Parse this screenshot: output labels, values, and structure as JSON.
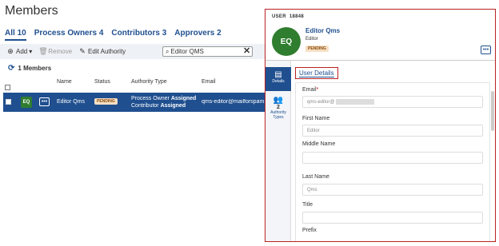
{
  "page": {
    "title": "Members"
  },
  "tabs": [
    {
      "label": "All",
      "count": "10",
      "active": true
    },
    {
      "label": "Process Owners",
      "count": "4"
    },
    {
      "label": "Contributors",
      "count": "3"
    },
    {
      "label": "Approvers",
      "count": "2"
    }
  ],
  "toolbar": {
    "add_label": "Add",
    "remove_label": "Remove",
    "edit_label": "Edit Authority",
    "search_value": "Editor QMS"
  },
  "list": {
    "count_label": "1 Members"
  },
  "table": {
    "headers": {
      "name": "Name",
      "status": "Status",
      "authority": "Authority Type",
      "email": "Email"
    },
    "row": {
      "initials": "EQ",
      "more": "•••",
      "name": "Editor Qms",
      "status": "PENDING",
      "authority_line1": "Process Owner",
      "authority_line1_status": "Assigned",
      "authority_line2": "Contributor",
      "authority_line2_status": "Assigned",
      "email": "qms-editor@mailforspam..."
    }
  },
  "panel": {
    "user_label": "USER",
    "user_id": "18848",
    "initials": "EQ",
    "name": "Editor Qms",
    "role": "Editor",
    "status": "PENDING",
    "more": "•••",
    "nav": {
      "details_label": "Details",
      "types_count": "2",
      "types_label_1": "Authority",
      "types_label_2": "Types"
    },
    "section_title": "User Details",
    "fields": {
      "email_label": "Email",
      "email_required": "*",
      "email_value": "qms-editor@",
      "first_name_label": "First Name",
      "first_name_value": "Editor",
      "middle_name_label": "Middle Name",
      "middle_name_value": "",
      "last_name_label": "Last Name",
      "last_name_value": "Qms",
      "title_label": "Title",
      "title_value": "",
      "prefix_label": "Prefix"
    }
  },
  "colors": {
    "primary": "#1f4f8f",
    "avatar": "#2f7d2f",
    "pending_bg": "#f6dfc4",
    "highlight_border": "#bb2222"
  }
}
